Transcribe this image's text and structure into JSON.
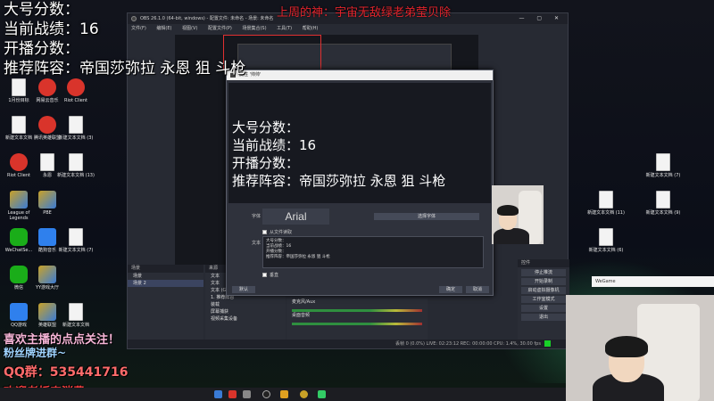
{
  "overlay": {
    "main_score_label": "大号分数：",
    "current_record": "当前战绩：16",
    "alt_score_label": "开播分数：",
    "lineup": "推荐阵容：帝国莎弥拉 永恩 狙 斗枪",
    "top_banner": "上周的神：宇宙无敌绿老弟莹贝除"
  },
  "desktop_icons": [
    {
      "label": "1月份目标",
      "glyph": "doc"
    },
    {
      "label": "网易云音乐",
      "glyph": "red"
    },
    {
      "label": "Riot Client",
      "glyph": "red"
    },
    {
      "label": "新建文本文档",
      "glyph": "doc"
    },
    {
      "label": "腾讯英雄联盟",
      "glyph": "red"
    },
    {
      "label": "新建文本文档 (3)",
      "glyph": "doc"
    },
    {
      "label": "Riot Client",
      "glyph": "red"
    },
    {
      "label": "永恩",
      "glyph": "doc"
    },
    {
      "label": "新建文本文档 (13)",
      "glyph": "doc"
    },
    {
      "label": "League of Legends",
      "glyph": "gold"
    },
    {
      "label": "PBE",
      "glyph": "gold"
    },
    {
      "label": "WeChatSe...",
      "glyph": "green"
    },
    {
      "label": "酷狗音乐",
      "glyph": "blue"
    },
    {
      "label": "新建文本文档 (7)",
      "glyph": "doc"
    },
    {
      "label": "微信",
      "glyph": "green"
    },
    {
      "label": "YY游戏大厅",
      "glyph": "gold"
    },
    {
      "label": "QQ游戏",
      "glyph": "blue"
    },
    {
      "label": "英雄联盟",
      "glyph": "gold"
    },
    {
      "label": "新建文本文档",
      "glyph": "doc"
    }
  ],
  "right_icons": [
    {
      "label": "新建文本文档 (7)"
    },
    {
      "label": "新建文本文档 (11)"
    },
    {
      "label": "新建文本文档 (9)"
    },
    {
      "label": "新建文本文档 (6)"
    }
  ],
  "obs": {
    "title": "OBS 26.1.0 (64-bit, windows) - 配置文件: 未命名 - 场景: 未命名",
    "menu": [
      "文件(F)",
      "编辑(E)",
      "视图(V)",
      "配置文件(P)",
      "场景集合(S)",
      "工具(T)",
      "帮助(H)"
    ],
    "scenes_header": "场景",
    "scenes": [
      "场景",
      "场景 2"
    ],
    "sources_header": "来源",
    "sources": [
      "文本",
      "文本",
      "文本 (GDI+)",
      "1. 推荐阵容",
      "装载",
      "屏幕捕获",
      "视频采集设备"
    ],
    "mixer_tracks": [
      "麦克风/Aux",
      "桌面音频"
    ],
    "controls_header": "控件",
    "controls": [
      "停止推流",
      "开始录制",
      "启动虚拟摄像机",
      "工作室模式",
      "设置",
      "退出"
    ],
    "status": "丢帧 0 (0.0%)   LIVE: 02:23:12   REC: 00:00:00   CPU: 1.4%, 30.00 fps"
  },
  "dialog": {
    "title": "属性 '帅帅'",
    "preview_text": "大号分数：\n当前战绩：16\n开播分数：\n推荐阵容：帝国莎弥拉 永恩 狙 斗枪",
    "font_label": "字体",
    "font_name": "Arial",
    "choose_font": "选择字体",
    "from_file": "从文件读取",
    "text_label": "文本",
    "text_value": "大号分数：\n当前战绩：16\n开播分数：\n推荐阵容：帝国莎弥拉 永恩 狙 斗枪",
    "vertical": "垂直",
    "defaults": "默认",
    "ok": "确定",
    "cancel": "取消"
  },
  "wegame": {
    "title": "WeGame"
  },
  "promo": {
    "line1": "喜欢主播的点点关注！",
    "line2": "粉丝牌进群~",
    "qq_group": "QQ群：535441716",
    "line4": "欢迎老板来消费"
  }
}
